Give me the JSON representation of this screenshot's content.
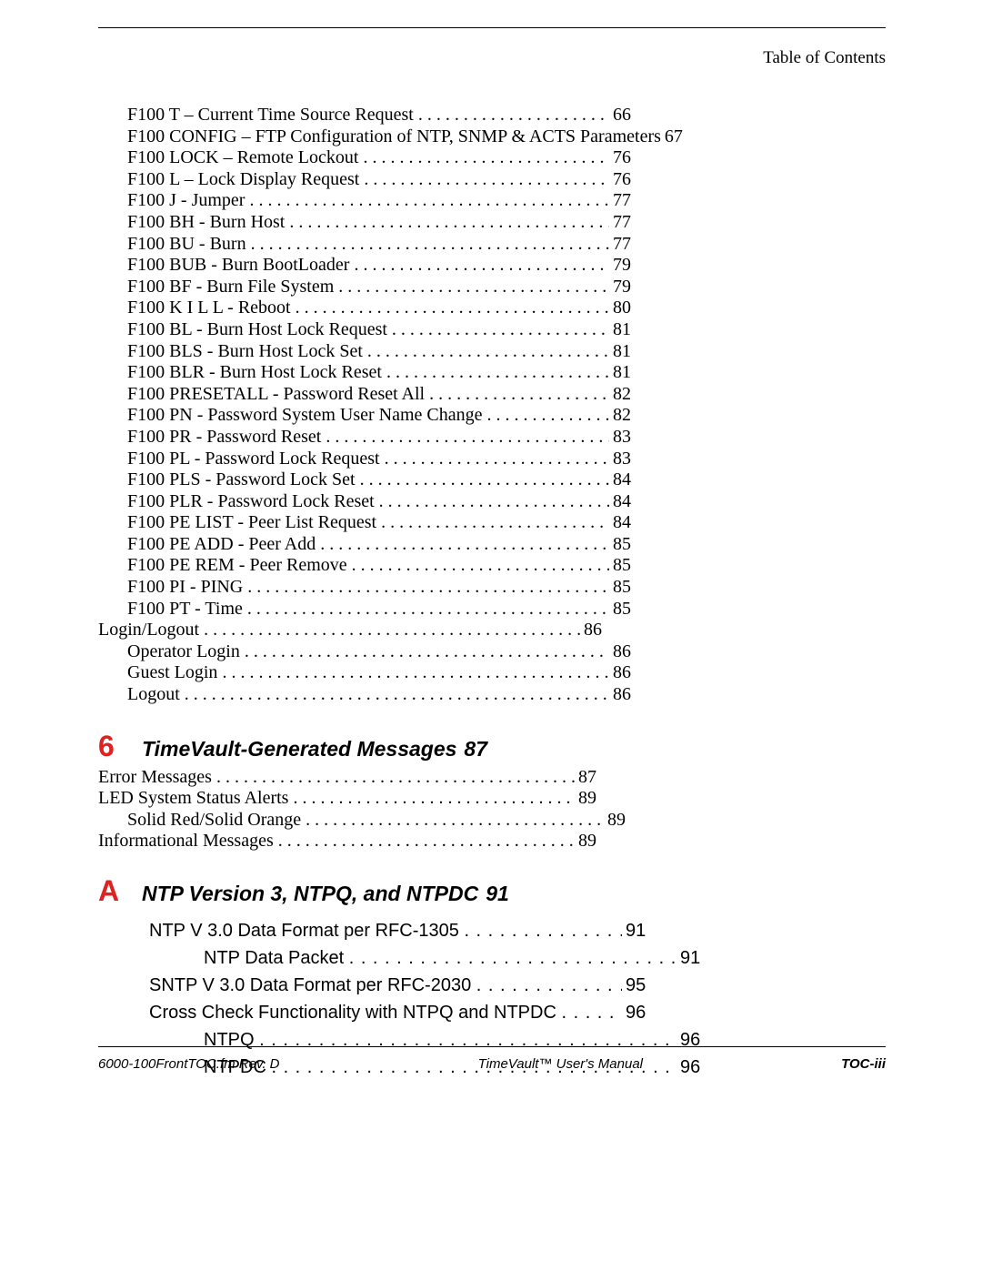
{
  "header": {
    "label": "Table of Contents"
  },
  "toc_main": [
    {
      "level": 1,
      "title": "F100 T – Current Time Source Request",
      "page": "66"
    },
    {
      "level": 1,
      "title": "F100 CONFIG – FTP Configuration of NTP, SNMP & ACTS Parameters",
      "page": "67",
      "noLeaders": true
    },
    {
      "level": 1,
      "title": "F100 LOCK – Remote Lockout",
      "page": "76"
    },
    {
      "level": 1,
      "title": "F100 L – Lock Display Request",
      "page": "76"
    },
    {
      "level": 1,
      "title": "F100 J - Jumper",
      "page": "77"
    },
    {
      "level": 1,
      "title": "F100 BH - Burn Host",
      "page": "77"
    },
    {
      "level": 1,
      "title": "F100 BU - Burn",
      "page": "77"
    },
    {
      "level": 1,
      "title": "F100 BUB - Burn BootLoader",
      "page": "79"
    },
    {
      "level": 1,
      "title": "F100 BF - Burn File System",
      "page": "79"
    },
    {
      "level": 1,
      "title": "F100 K I L L - Reboot",
      "page": "80"
    },
    {
      "level": 1,
      "title": "F100 BL - Burn Host Lock Request",
      "page": "81"
    },
    {
      "level": 1,
      "title": "F100 BLS - Burn Host Lock Set",
      "page": "81"
    },
    {
      "level": 1,
      "title": "F100 BLR - Burn Host Lock Reset",
      "page": "81"
    },
    {
      "level": 1,
      "title": "F100 PRESETALL - Password Reset All",
      "page": "82"
    },
    {
      "level": 1,
      "title": "F100 PN - Password System User Name Change",
      "page": "82"
    },
    {
      "level": 1,
      "title": "F100 PR - Password Reset",
      "page": "83"
    },
    {
      "level": 1,
      "title": "F100 PL - Password Lock Request",
      "page": "83"
    },
    {
      "level": 1,
      "title": "F100 PLS - Password Lock Set",
      "page": "84"
    },
    {
      "level": 1,
      "title": "F100 PLR - Password Lock Reset",
      "page": "84"
    },
    {
      "level": 1,
      "title": "F100 PE LIST - Peer List Request",
      "page": "84"
    },
    {
      "level": 1,
      "title": "F100 PE ADD - Peer Add",
      "page": "85"
    },
    {
      "level": 1,
      "title": "F100 PE REM - Peer Remove",
      "page": "85"
    },
    {
      "level": 1,
      "title": "F100 PI - PING",
      "page": "85"
    },
    {
      "level": 1,
      "title": "F100 PT - Time",
      "page": "85"
    },
    {
      "level": 0,
      "title": "Login/Logout",
      "page": "86"
    },
    {
      "level": 1,
      "title": "Operator Login",
      "page": "86"
    },
    {
      "level": 1,
      "title": "Guest Login",
      "page": "86"
    },
    {
      "level": 1,
      "title": "Logout",
      "page": "86"
    }
  ],
  "chapter6": {
    "num": "6",
    "title": "TimeVault-Generated Messages",
    "page": "87",
    "items": [
      {
        "level": 0,
        "title": "Error Messages",
        "page": "87"
      },
      {
        "level": 0,
        "title": "LED System Status Alerts",
        "page": "89"
      },
      {
        "level": 1,
        "title": "Solid Red/Solid Orange",
        "page": "89"
      },
      {
        "level": 0,
        "title": "Informational Messages",
        "page": "89"
      }
    ]
  },
  "appendixA": {
    "num": "A",
    "title": "NTP Version 3, NTPQ, and NTPDC",
    "page": "91",
    "items": [
      {
        "level": 1,
        "title": "NTP V 3.0 Data Format per RFC-1305",
        "page": "91"
      },
      {
        "level": 2,
        "title": "NTP Data Packet",
        "page": "91"
      },
      {
        "level": 1,
        "title": "SNTP V 3.0 Data Format per RFC-2030",
        "page": "95"
      },
      {
        "level": 1,
        "title": "Cross Check Functionality with NTPQ and NTPDC",
        "page": "96"
      },
      {
        "level": 2,
        "title": "NTPQ",
        "page": "96"
      },
      {
        "level": 2,
        "title": "NTPDC",
        "page": "96"
      }
    ]
  },
  "footer": {
    "left": "6000-100FrontTOC.fm Rev. D",
    "center": "TimeVault™ User's Manual",
    "right": "TOC-iii"
  }
}
